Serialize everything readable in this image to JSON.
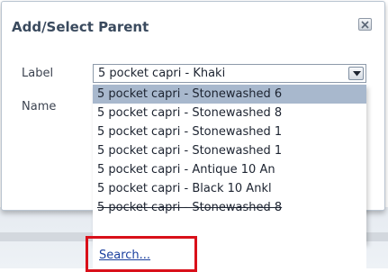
{
  "dialog": {
    "title": "Add/Select Parent",
    "label_field_label": "Label",
    "name_field_label": "Name"
  },
  "select": {
    "value": "5 pocket capri - Khaki"
  },
  "dropdown": {
    "options": [
      "5 pocket capri - Stonewashed 6",
      "5 pocket capri - Stonewashed 8",
      "5 pocket capri - Stonewashed 1",
      "5 pocket capri - Stonewashed 1",
      "5 pocket capri - Antique 10 An",
      "5 pocket capri - Black 10 Ankl",
      "5 pocket capri - Stonewashed 8"
    ],
    "selected_index": 0,
    "search_label": "Search..."
  },
  "colors": {
    "title": "#3a4a5e",
    "selected_row": "#a8b8cd",
    "link": "#1a3f9e",
    "highlight": "#d9101a"
  }
}
